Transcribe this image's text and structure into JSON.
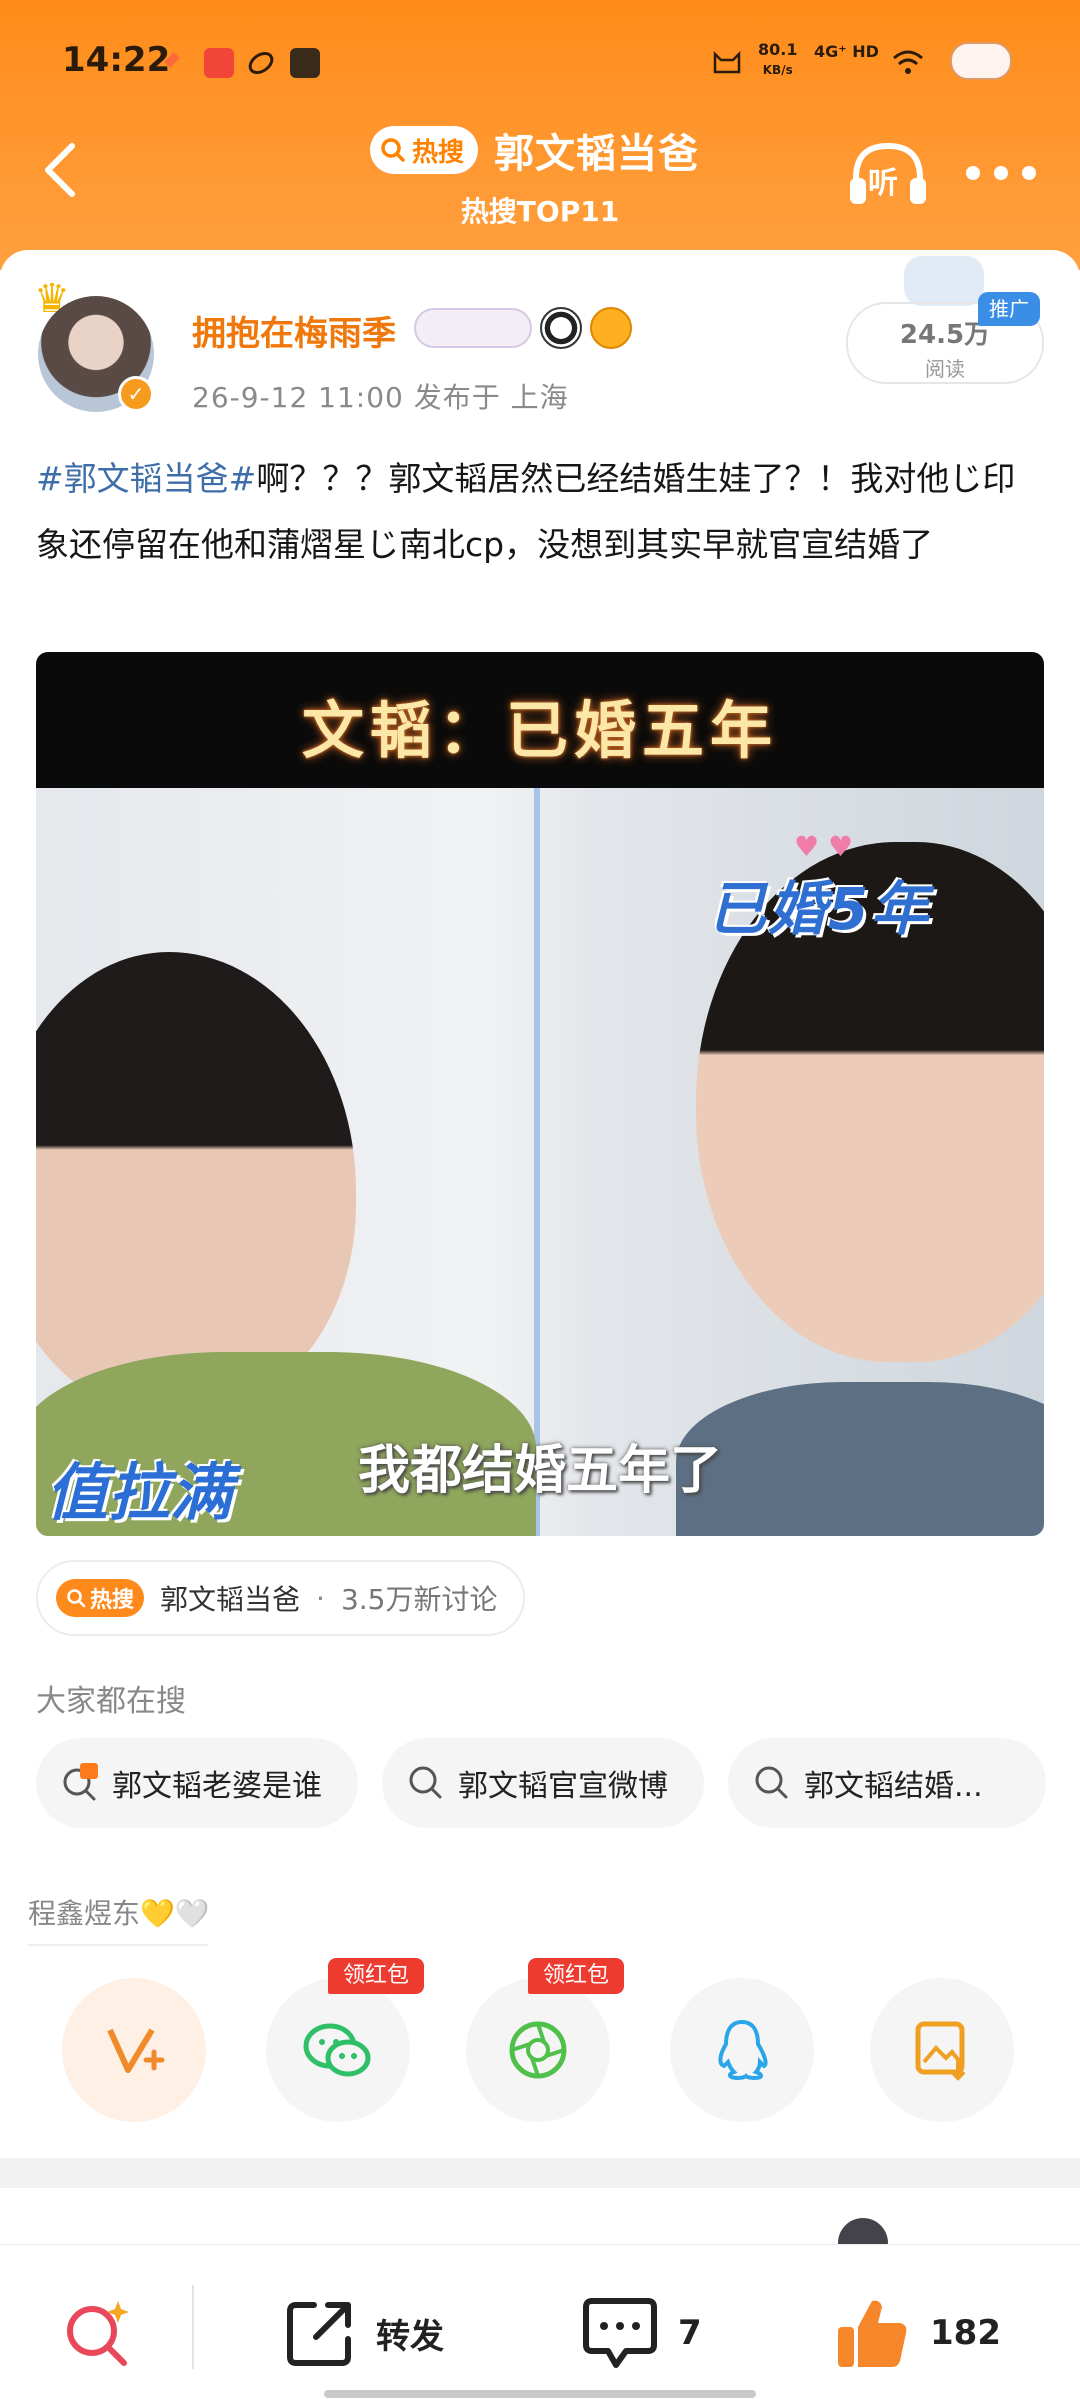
{
  "status": {
    "time": "14:22",
    "net_speed": "80.1",
    "net_unit": "KB/s",
    "signal": "4G⁺ HD"
  },
  "header": {
    "hot_label": "热搜",
    "title": "郭文韬当爸",
    "subtitle": "热搜TOP11",
    "listen_label": "听"
  },
  "post": {
    "username": "拥抱在梅雨季",
    "meta": "26-9-12  11:00  发布于  上海",
    "reads": "24.5万",
    "reads_label": "阅读",
    "promo": "推广",
    "hashtag": "#郭文韬当爸#",
    "body": "啊？？？郭文韬居然已经结婚生娃了？！我对他じ印象还停留在他和蒲熠星じ南北cp，没想到其实早就官宣结婚了",
    "image": {
      "top_caption": "文韬：已婚五年",
      "sticker_married": "已婚5年",
      "sticker_full": "值拉满",
      "subtitle": "我都结婚五年了"
    }
  },
  "topic": {
    "hot_label": "热搜",
    "name": "郭文韬当爸",
    "separator": "·",
    "discussions": "3.5万新讨论"
  },
  "searches": {
    "label": "大家都在搜",
    "items": [
      "郭文韬老婆是谁",
      "郭文韬官宣微博",
      "郭文韬结婚..."
    ]
  },
  "share": {
    "user": "程鑫煜东💛🤍",
    "redpack_label": "领红包",
    "buttons": [
      "vplus-icon",
      "wechat-icon",
      "moments-icon",
      "qq-icon",
      "save-image-icon"
    ]
  },
  "bottom": {
    "repost_label": "转发",
    "comments": "7",
    "likes": "182"
  },
  "colors": {
    "header_orange": "#ff8c1a",
    "username_orange": "#f0780a",
    "hashtag_blue": "#3e6ea8"
  }
}
